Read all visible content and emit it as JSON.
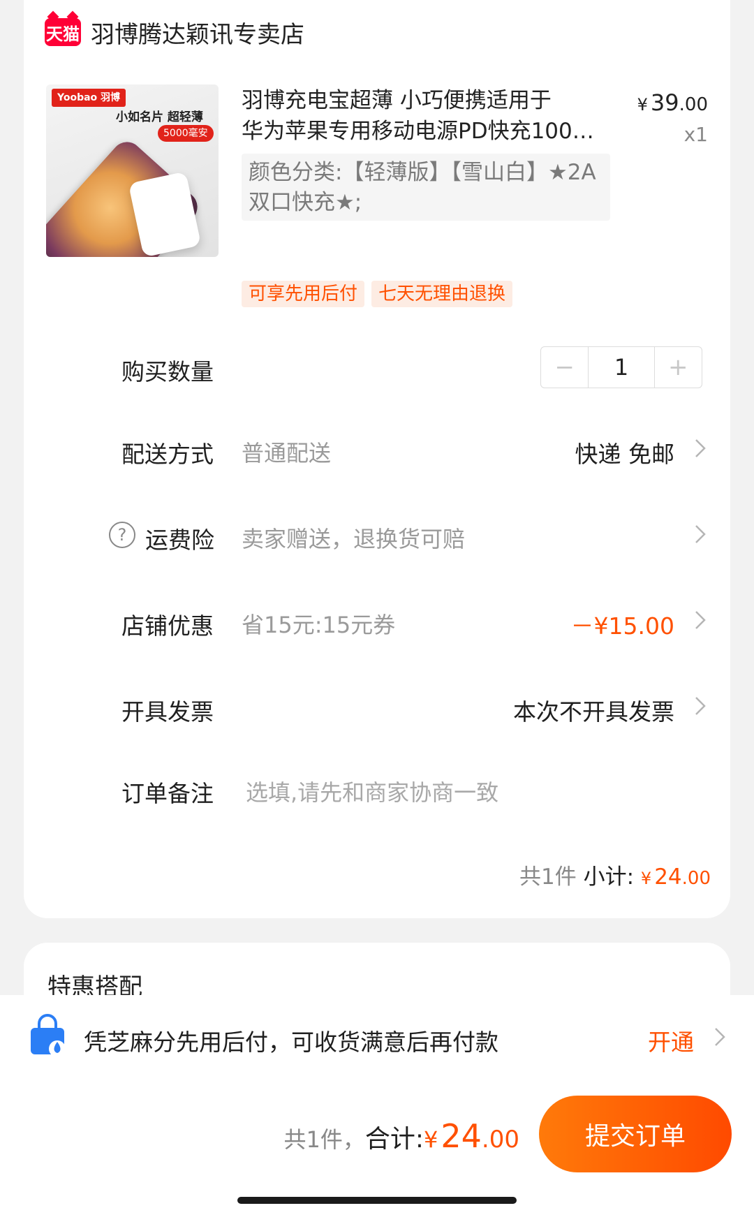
{
  "shop": {
    "badge": "天猫",
    "name": "羽博腾达颖讯专卖店"
  },
  "product": {
    "thumb_brand": "Yoobao 羽博",
    "thumb_tagline": "小如名片 超轻薄",
    "thumb_spec": "5000毫安",
    "title_line1": "羽博充电宝超薄 小巧便携适用于",
    "title_line2": "华为苹果专用移动电源PD快充100…",
    "price_currency": "¥",
    "price_int": "39",
    "price_dec": ".00",
    "quantity_text": "x1",
    "sku_line1": "颜色分类:【轻薄版】【雪山白】★2A",
    "sku_line2": "双口快充★;",
    "tags": [
      "可享先用后付",
      "七天无理由退换"
    ]
  },
  "rows": {
    "quantity": {
      "label": "购买数量",
      "minus": "−",
      "value": "1",
      "plus": "+"
    },
    "delivery": {
      "label": "配送方式",
      "sub": "普通配送",
      "value": "快递 免邮"
    },
    "insurance": {
      "icon_char": "?",
      "label": "运费险",
      "sub": "卖家赠送，退换货可赔"
    },
    "shop_discount": {
      "label": "店铺优惠",
      "sub": "省15元:15元券",
      "value": "－¥15.00"
    },
    "invoice": {
      "label": "开具发票",
      "value": "本次不开具发票"
    },
    "note": {
      "label": "订单备注",
      "placeholder": "选填,请先和商家协商一致"
    }
  },
  "subtotal": {
    "count": "共1件",
    "label": "小计:",
    "currency": "¥",
    "int": "24",
    "dec": ".00"
  },
  "combo": {
    "title": "特惠搭配"
  },
  "pay_later": {
    "text": "凭芝麻分先用后付，可收货满意后再付款",
    "link": "开通"
  },
  "footer": {
    "count": "共1件，",
    "label": "合计:",
    "currency": "¥",
    "int": "24",
    "dec": ".00",
    "submit": "提交订单"
  },
  "colors": {
    "accent": "#ff5000",
    "tmall_red": "#ff0036",
    "background": "#f2f2f2"
  }
}
